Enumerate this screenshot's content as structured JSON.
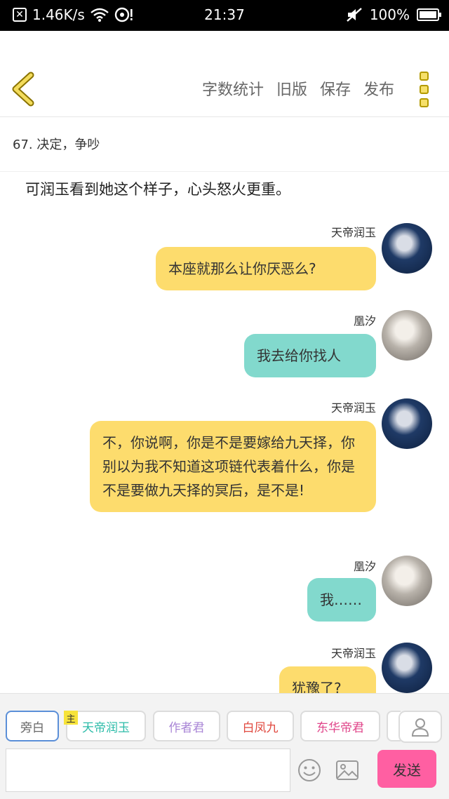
{
  "status_bar": {
    "speed": "1.46K/s",
    "time": "21:37",
    "battery": "100%"
  },
  "toolbar": {
    "actions": [
      "字数统计",
      "旧版",
      "保存",
      "发布"
    ]
  },
  "chapter": {
    "title": "67. 决定，争吵"
  },
  "chat": {
    "narration": "可润玉看到她这个样子，心头怒火更重。",
    "messages": [
      {
        "name": "天帝润玉",
        "text": "本座就那么让你厌恶么?",
        "color": "#fddc6d"
      },
      {
        "name": "凰汐",
        "text": "我去给你找人",
        "color": "#82d9cd"
      },
      {
        "name": "天帝润玉",
        "text": "不，你说啊，你是不是要嫁给九天择，你别以为我不知道这项链代表着什么，你是不是要做九天择的冥后，是不是!",
        "color": "#fddc6d"
      },
      {
        "name": "凰汐",
        "text": "我……",
        "color": "#82d9cd"
      },
      {
        "name": "天帝润玉",
        "text": "犹豫了?",
        "color": "#fddc6d"
      }
    ]
  },
  "composer": {
    "roles": [
      {
        "label": "旁白",
        "color": "#666666"
      },
      {
        "label": "天帝润玉",
        "color": "#2bbba8"
      },
      {
        "label": "作者君",
        "color": "#a985d6"
      },
      {
        "label": "白凤九",
        "color": "#e0483e"
      },
      {
        "label": "东华帝君",
        "color": "#e0458a"
      }
    ],
    "host_badge": "主",
    "input_value": "",
    "send_label": "发送"
  },
  "colors": {
    "accent_yellow": "#fddc6d",
    "accent_teal": "#82d9cd",
    "send_pink": "#ff5fa2",
    "active_border": "#5b8fd8"
  }
}
